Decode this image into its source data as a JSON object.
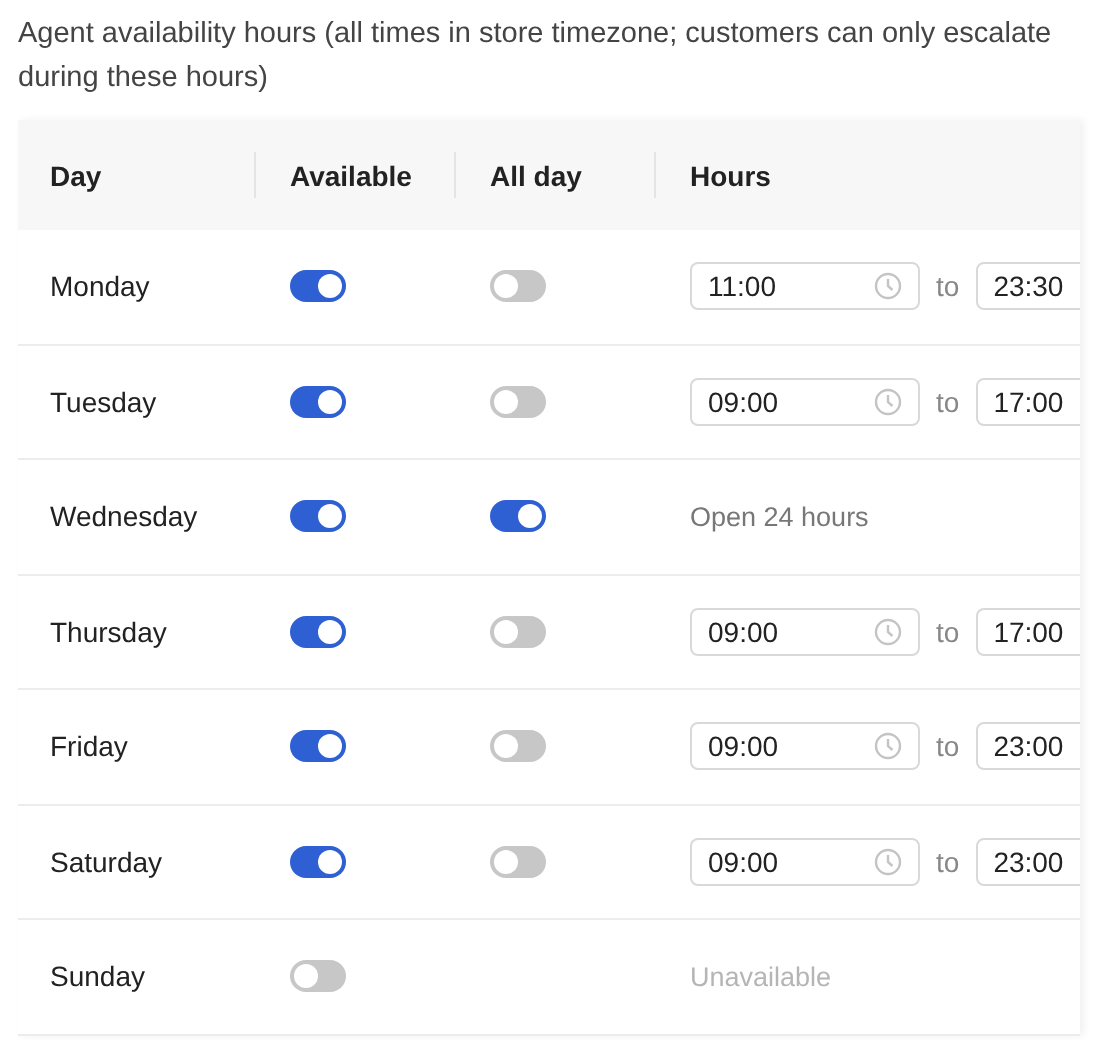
{
  "caption": "Agent availability hours (all times in store timezone; customers can only escalate during these hours)",
  "table": {
    "columns": [
      "Day",
      "Available",
      "All day",
      "Hours"
    ],
    "rows": [
      {
        "day": "Monday",
        "available": true,
        "all_day": false,
        "hours": {
          "kind": "range",
          "from": "11:00",
          "joiner": "to",
          "to": "23:30"
        }
      },
      {
        "day": "Tuesday",
        "available": true,
        "all_day": false,
        "hours": {
          "kind": "range",
          "from": "09:00",
          "joiner": "to",
          "to": "17:00"
        }
      },
      {
        "day": "Wednesday",
        "available": true,
        "all_day": true,
        "hours": {
          "kind": "open",
          "text": "Open 24 hours"
        }
      },
      {
        "day": "Thursday",
        "available": true,
        "all_day": false,
        "hours": {
          "kind": "range",
          "from": "09:00",
          "joiner": "to",
          "to": "17:00"
        }
      },
      {
        "day": "Friday",
        "available": true,
        "all_day": false,
        "hours": {
          "kind": "range",
          "from": "09:00",
          "joiner": "to",
          "to": "23:00"
        }
      },
      {
        "day": "Saturday",
        "available": true,
        "all_day": false,
        "hours": {
          "kind": "range",
          "from": "09:00",
          "joiner": "to",
          "to": "23:00"
        }
      },
      {
        "day": "Sunday",
        "available": false,
        "hours": {
          "kind": "unavailable",
          "text": "Unavailable"
        }
      }
    ]
  }
}
